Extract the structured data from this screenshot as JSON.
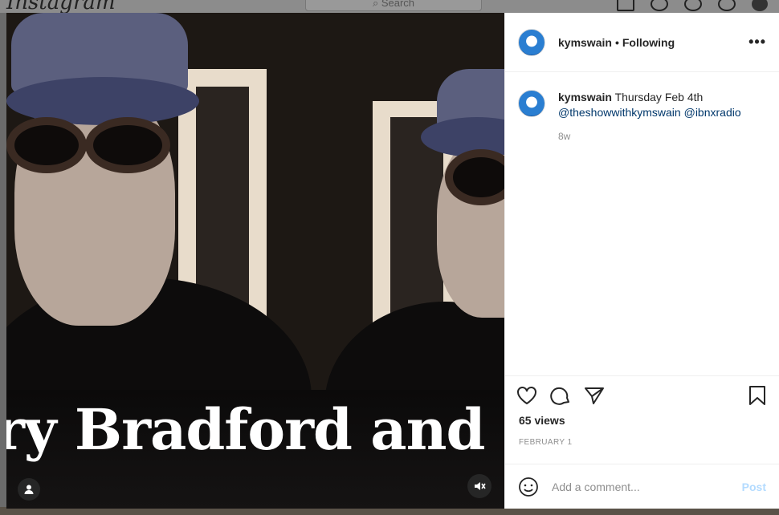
{
  "background": {
    "logo": "Instagram",
    "search_placeholder": "Search"
  },
  "media": {
    "overlay_text": "ry Bradford and M",
    "user_tag_icon": "user-icon",
    "mute_icon": "speaker-muted-icon"
  },
  "post": {
    "header": {
      "username": "kymswain",
      "separator": "•",
      "follow_status": "Following",
      "more": "•••"
    },
    "caption": {
      "username": "kymswain",
      "text": "Thursday Feb 4th",
      "mention1": "@theshowwithkymswain",
      "mention2": "@ibnxradio",
      "age": "8w"
    },
    "views": "65 views",
    "date": "FEBRUARY 1",
    "comment_placeholder": "Add a comment...",
    "post_label": "Post"
  },
  "colors": {
    "accent_link": "#00376b",
    "post_button_disabled": "#b3dbff",
    "text_primary": "#262626",
    "text_secondary": "#8e8e8e"
  }
}
